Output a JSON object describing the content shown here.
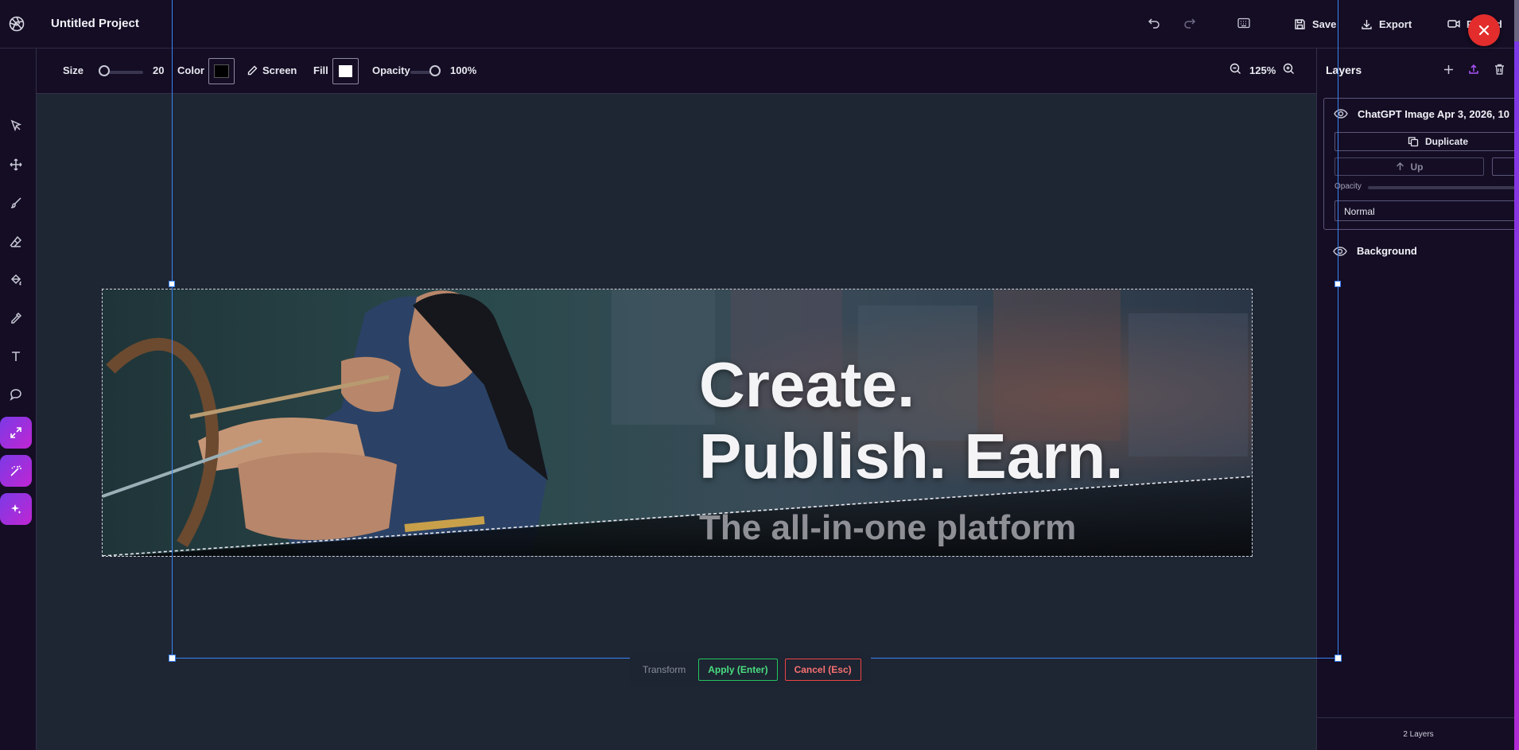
{
  "header": {
    "project_title": "Untitled Project",
    "save_label": "Save",
    "export_label": "Export",
    "record_label": "Record"
  },
  "toolbar": {
    "size_label": "Size",
    "size_value": "20",
    "color_label": "Color",
    "color_value": "#000000",
    "blend_button_label": "Screen",
    "fill_label": "Fill",
    "fill_value": "#ffffff",
    "opacity_label": "Opacity",
    "opacity_value": "100%",
    "zoom_value": "125%"
  },
  "tools": [
    {
      "icon": "select-icon"
    },
    {
      "icon": "move-icon"
    },
    {
      "icon": "brush-icon"
    },
    {
      "icon": "eraser-icon"
    },
    {
      "icon": "paint-bucket-icon"
    },
    {
      "icon": "eyedropper-icon"
    },
    {
      "icon": "text-icon"
    },
    {
      "icon": "speech-bubble-icon"
    },
    {
      "icon": "resize-icon",
      "active": true
    },
    {
      "icon": "magic-wand-icon"
    },
    {
      "icon": "sparkle-icon"
    }
  ],
  "canvas": {
    "headline_1": "Create.",
    "headline_2": "Publish. Earn.",
    "subheadline": "The all-in-one platform"
  },
  "transform": {
    "label": "Transform",
    "apply_label": "Apply (Enter)",
    "cancel_label": "Cancel (Esc)"
  },
  "layers": {
    "title": "Layers",
    "items": [
      {
        "name": "ChatGPT Image Apr 3, 2026, 10",
        "duplicate_label": "Duplicate",
        "up_label": "Up",
        "opacity_label": "Opacity",
        "blend_mode": "Normal"
      },
      {
        "name": "Background"
      }
    ],
    "count_label": "2 Layers"
  },
  "colors": {
    "accent": "#3b82f6",
    "apply": "#22c55e",
    "cancel": "#ef4444",
    "close": "#e32d2d",
    "purple_tool": "#9333ea"
  }
}
